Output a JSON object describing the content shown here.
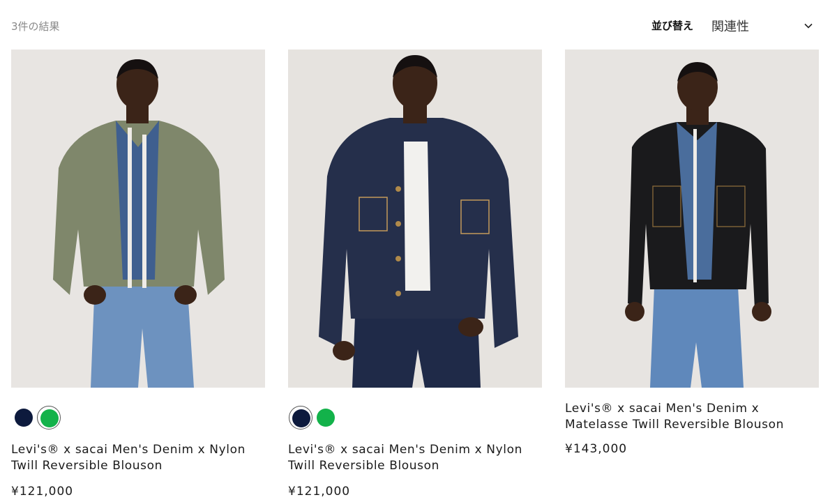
{
  "results": {
    "count_text": "3件の結果"
  },
  "sort": {
    "label": "並び替え",
    "selected": "関連性"
  },
  "products": [
    {
      "name": "Levi's® x sacai Men's Denim x Nylon Twill Reversible Blouson",
      "price": "¥121,000",
      "image_icon": "jacket-photo",
      "jacket_color": "#7f876b",
      "swatches": [
        {
          "color": "#0d1a3d",
          "selected": false
        },
        {
          "color": "#13b24a",
          "selected": true
        }
      ]
    },
    {
      "name": "Levi's® x sacai Men's Denim x Nylon Twill Reversible Blouson",
      "price": "¥121,000",
      "image_icon": "jacket-photo",
      "jacket_color": "#252f4b",
      "swatches": [
        {
          "color": "#0d1a3d",
          "selected": true
        },
        {
          "color": "#13b24a",
          "selected": false
        }
      ]
    },
    {
      "name": "Levi's® x sacai Men's Denim x Matelasse Twill Reversible Blouson",
      "price": "¥143,000",
      "image_icon": "jacket-photo",
      "jacket_color": "#1a1a1c",
      "swatches": []
    }
  ]
}
